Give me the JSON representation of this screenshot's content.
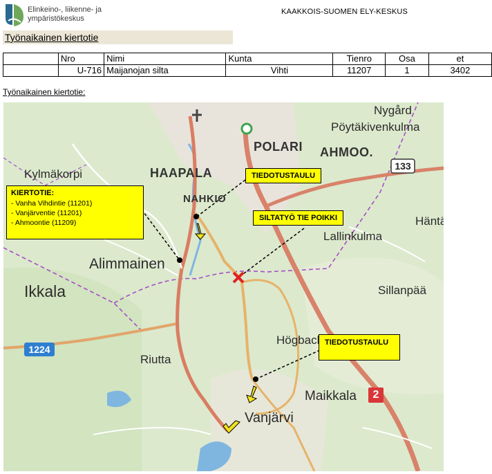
{
  "header": {
    "logo_line1": "Elinkeino-, liikenne- ja",
    "logo_line2": "ympäristökeskus",
    "organization": "KAAKKOIS-SUOMEN ELY-KESKUS"
  },
  "title": "Työnaikainen kiertotie",
  "table": {
    "headers": [
      "",
      "Nro",
      "Nimi",
      "Kunta",
      "Tienro",
      "Osa",
      "et"
    ],
    "row": [
      "",
      "U-716",
      "Maijanojan silta",
      "Vihti",
      "11207",
      "1",
      "3402"
    ]
  },
  "map_caption": "Työnaikainen kiertotie:",
  "map": {
    "places": {
      "nygard": "Nygård",
      "poytakivenkulma": "Pöytäkivenkulma",
      "polari": "POLARI",
      "ahmoo": "AHMOO.",
      "kylmakorpi": "Kylmäkorpi",
      "haapala": "HAAPALA",
      "nahkio": "NAHKIO",
      "hanta": "Häntä",
      "lallinkulma": "Lallinkulma",
      "alimmainen": "Alimmainen",
      "ikkala": "Ikkala",
      "sillanpaa": "Sillanpää",
      "hogbacka": "Högbacka",
      "riutta": "Riutta",
      "maikkala": "Maikkala",
      "vanjarvi": "Vanjärvi"
    },
    "shields": {
      "r133": "133",
      "r1224": "1224",
      "r2": "2"
    },
    "callouts": {
      "tiedotustaulu_top": "TIEDOTUSTAULU",
      "siltatyo": "SILTATYÖ TIE POIKKI",
      "tiedotustaulu_bottom": "TIEDOTUSTAULU",
      "kiertotie_title": "KIERTOTIE:",
      "kiertotie_items": [
        "- Vanha Vihdintie (11201)",
        "- Vanjärventie (11201)",
        "- Ahmoontie (11209)"
      ]
    }
  },
  "colors": {
    "callout": "#ffff00",
    "map_green": "#d9e8c9",
    "main_road": "#d9826a",
    "minor_road": "#e6b36a",
    "boundary": "#a64dc7",
    "water": "#7fb6e0",
    "shield_blue": "#2f7fd0",
    "shield_red": "#d9363a"
  }
}
